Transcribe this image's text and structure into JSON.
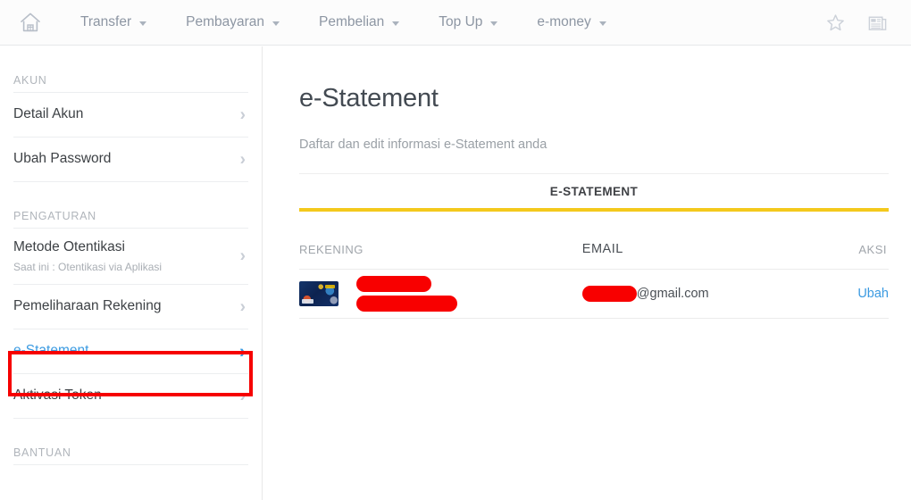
{
  "topnav": {
    "home_icon": "home-icon",
    "items": [
      {
        "label": "Transfer",
        "has_caret": true
      },
      {
        "label": "Pembayaran",
        "has_caret": true
      },
      {
        "label": "Pembelian",
        "has_caret": true
      },
      {
        "label": "Top Up",
        "has_caret": true
      },
      {
        "label": "e-money",
        "has_caret": true
      }
    ],
    "right_icons": [
      {
        "name": "star-favorite-icon"
      },
      {
        "name": "newspaper-icon"
      }
    ]
  },
  "sidebar": {
    "groups": [
      {
        "label": "AKUN",
        "items": [
          {
            "label": "Detail Akun",
            "sub": "",
            "active": false,
            "chevron": "›"
          },
          {
            "label": "Ubah Password",
            "sub": "",
            "active": false,
            "chevron": "›"
          }
        ]
      },
      {
        "label": "PENGATURAN",
        "items": [
          {
            "label": "Metode Otentikasi",
            "sub": "Saat ini : Otentikasi via Aplikasi",
            "active": false,
            "chevron": "›"
          },
          {
            "label": "Pemeliharaan Rekening",
            "sub": "",
            "active": false,
            "chevron": "›"
          },
          {
            "label": "e-Statement",
            "sub": "",
            "active": true,
            "chevron": "›"
          },
          {
            "label": "Aktivasi Token",
            "sub": "",
            "active": false,
            "chevron": "›"
          }
        ]
      },
      {
        "label": "BANTUAN",
        "items": []
      }
    ],
    "annotation": {
      "name": "red-highlight-box",
      "color": "#f60000",
      "target": "e-Statement"
    }
  },
  "main": {
    "title": "e-Statement",
    "subtitle": "Daftar dan edit informasi e-Statement anda",
    "tabs": [
      {
        "label": "E-STATEMENT",
        "active": true
      }
    ],
    "accent_color": "#f4c91c",
    "table": {
      "headers": {
        "rekening": "REKENING",
        "email": "EMAIL",
        "aksi": "AKSI"
      },
      "rows": [
        {
          "card_icon": "debit-card-thumbnail",
          "account_redacted_line1": "",
          "account_redacted_line2": "",
          "email_redacted_prefix": "",
          "email_domain": "@gmail.com",
          "action_label": "Ubah"
        }
      ]
    }
  }
}
